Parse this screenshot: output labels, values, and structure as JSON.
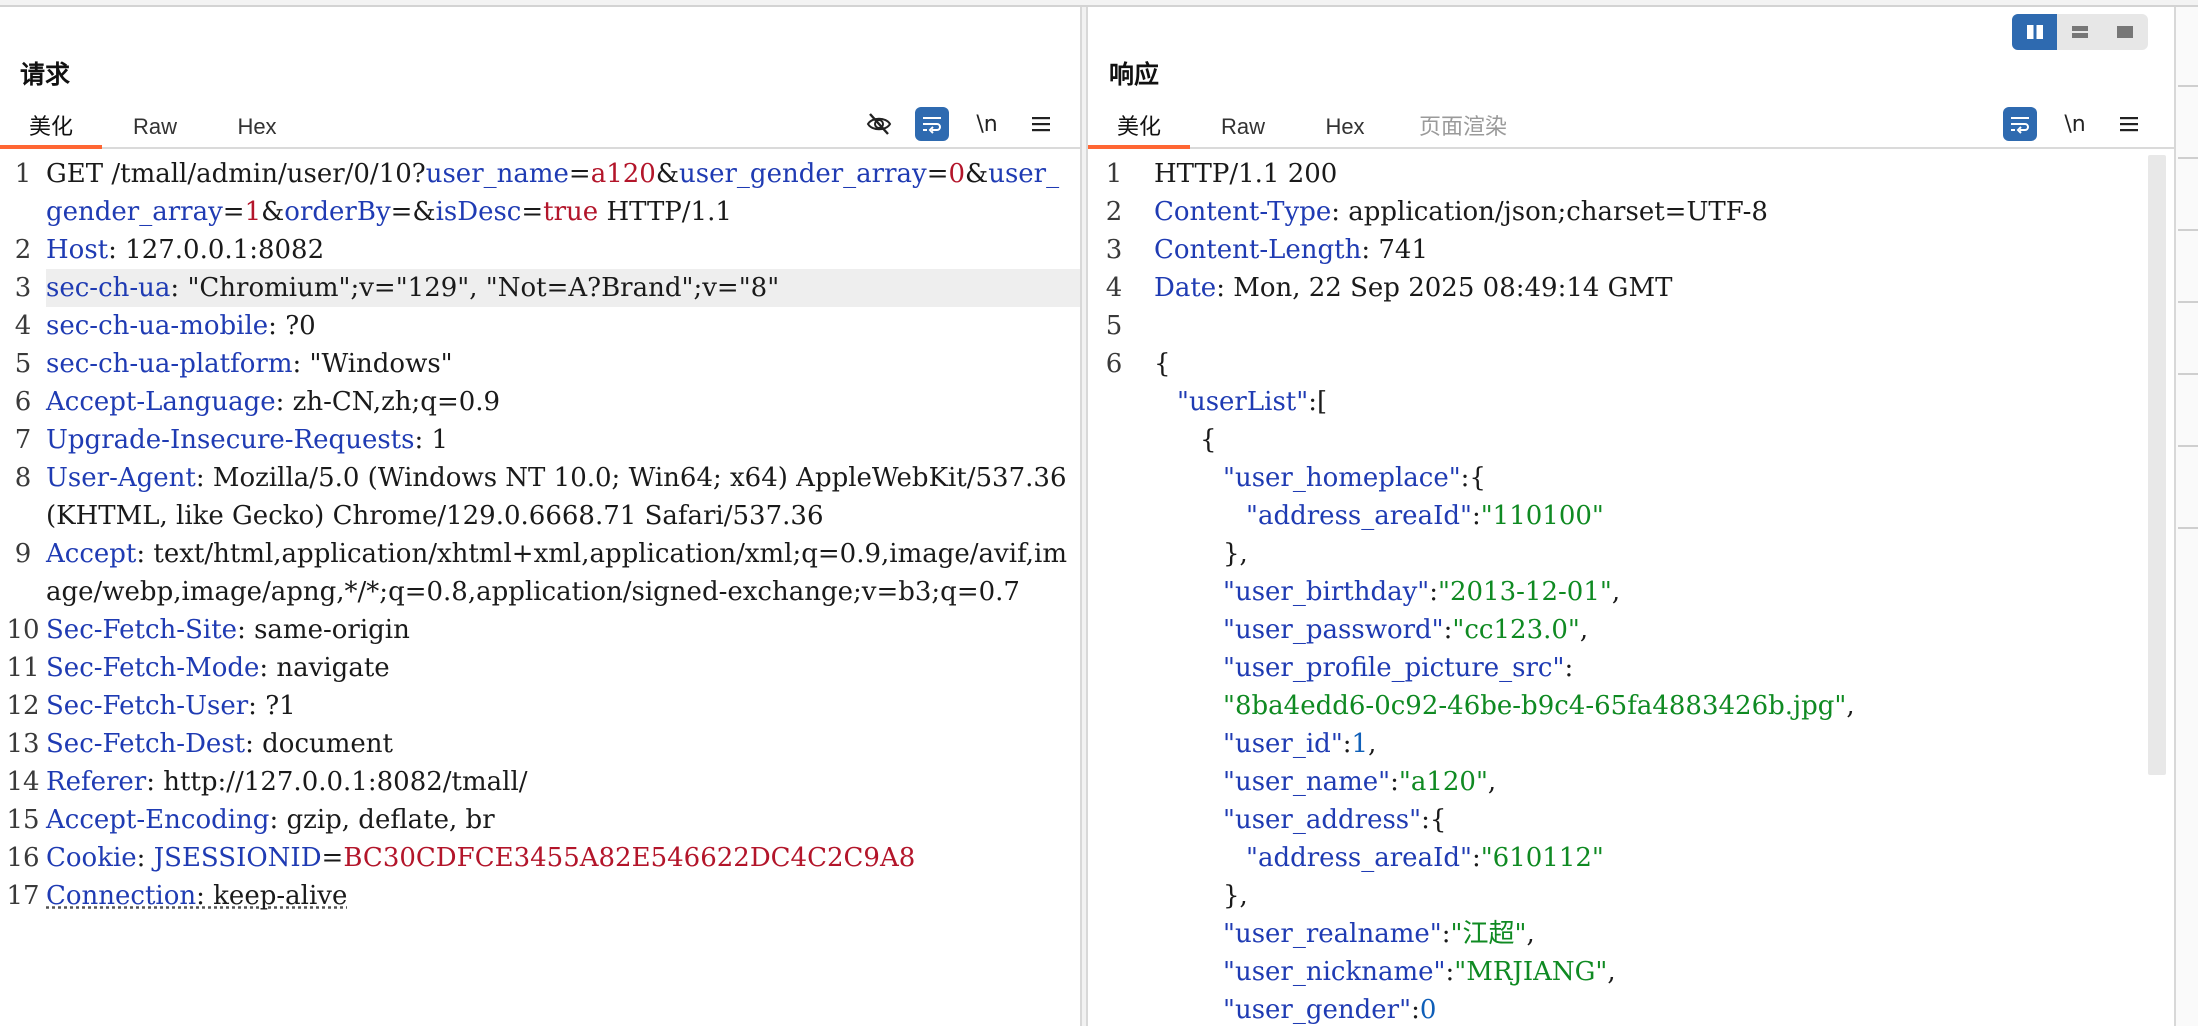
{
  "request": {
    "title": "请求",
    "tabs": [
      {
        "label": "美化",
        "active": true
      },
      {
        "label": "Raw",
        "active": false
      },
      {
        "label": "Hex",
        "active": false
      }
    ],
    "tools": {
      "wrap_newline": "\\n",
      "menu_icon": "menu-icon",
      "hide_icon": "eye-off-icon",
      "wrap_icon": "wrap-icon"
    },
    "lines": [
      {
        "n": "1",
        "segs": [
          {
            "t": "GET /tmall/admin/user/0/10?",
            "c": "dim"
          },
          {
            "t": "user_name",
            "c": "k"
          },
          {
            "t": "=",
            "c": "dim"
          },
          {
            "t": "a120",
            "c": "v"
          },
          {
            "t": "&",
            "c": "dim"
          },
          {
            "t": "user_gender_array",
            "c": "k"
          },
          {
            "t": "=",
            "c": "dim"
          },
          {
            "t": "0",
            "c": "v"
          },
          {
            "t": "&",
            "c": "dim"
          },
          {
            "t": "user_gender_array",
            "c": "k"
          },
          {
            "t": "=",
            "c": "dim"
          },
          {
            "t": "1",
            "c": "v"
          },
          {
            "t": "&",
            "c": "dim"
          },
          {
            "t": "orderBy",
            "c": "k"
          },
          {
            "t": "=&",
            "c": "dim"
          },
          {
            "t": "isDesc",
            "c": "k"
          },
          {
            "t": "=",
            "c": "dim"
          },
          {
            "t": "true",
            "c": "v"
          },
          {
            "t": " HTTP/1.1",
            "c": "dim"
          }
        ]
      },
      {
        "n": "2",
        "segs": [
          {
            "t": "Host",
            "c": "k"
          },
          {
            "t": ": 127.0.0.1:8082",
            "c": "dim"
          }
        ]
      },
      {
        "n": "3",
        "hl": true,
        "segs": [
          {
            "t": "sec-ch-ua",
            "c": "k"
          },
          {
            "t": ": \"Chromium\";v=\"129\", \"Not=A?Brand\";v=\"8\"",
            "c": "dim"
          }
        ]
      },
      {
        "n": "4",
        "segs": [
          {
            "t": "sec-ch-ua-mobile",
            "c": "k"
          },
          {
            "t": ": ?0",
            "c": "dim"
          }
        ]
      },
      {
        "n": "5",
        "segs": [
          {
            "t": "sec-ch-ua-platform",
            "c": "k"
          },
          {
            "t": ": \"Windows\"",
            "c": "dim"
          }
        ]
      },
      {
        "n": "6",
        "segs": [
          {
            "t": "Accept-Language",
            "c": "k"
          },
          {
            "t": ": zh-CN,zh;q=0.9",
            "c": "dim"
          }
        ]
      },
      {
        "n": "7",
        "segs": [
          {
            "t": "Upgrade-Insecure-Requests",
            "c": "k"
          },
          {
            "t": ": 1",
            "c": "dim"
          }
        ]
      },
      {
        "n": "8",
        "segs": [
          {
            "t": "User-Agent",
            "c": "k"
          },
          {
            "t": ": Mozilla/5.0 (Windows NT 10.0; Win64; x64) AppleWebKit/537.36 (KHTML, like Gecko) Chrome/129.0.6668.71 Safari/537.36",
            "c": "dim"
          }
        ]
      },
      {
        "n": "9",
        "segs": [
          {
            "t": "Accept",
            "c": "k"
          },
          {
            "t": ": text/html,application/xhtml+xml,application/xml;q=0.9,image/avif,image/webp,image/apng,*/*;q=0.8,application/signed-exchange;v=b3;q=0.7",
            "c": "dim"
          }
        ]
      },
      {
        "n": "10",
        "segs": [
          {
            "t": "Sec-Fetch-Site",
            "c": "k"
          },
          {
            "t": ": same-origin",
            "c": "dim"
          }
        ]
      },
      {
        "n": "11",
        "segs": [
          {
            "t": "Sec-Fetch-Mode",
            "c": "k"
          },
          {
            "t": ": navigate",
            "c": "dim"
          }
        ]
      },
      {
        "n": "12",
        "segs": [
          {
            "t": "Sec-Fetch-User",
            "c": "k"
          },
          {
            "t": ": ?1",
            "c": "dim"
          }
        ]
      },
      {
        "n": "13",
        "segs": [
          {
            "t": "Sec-Fetch-Dest",
            "c": "k"
          },
          {
            "t": ": document",
            "c": "dim"
          }
        ]
      },
      {
        "n": "14",
        "segs": [
          {
            "t": "Referer",
            "c": "k"
          },
          {
            "t": ": http://127.0.0.1:8082/tmall/",
            "c": "dim"
          }
        ]
      },
      {
        "n": "15",
        "segs": [
          {
            "t": "Accept-Encoding",
            "c": "k"
          },
          {
            "t": ": gzip, deflate, br",
            "c": "dim"
          }
        ]
      },
      {
        "n": "16",
        "segs": [
          {
            "t": "Cookie",
            "c": "k"
          },
          {
            "t": ": ",
            "c": "dim"
          },
          {
            "t": "JSESSIONID",
            "c": "k"
          },
          {
            "t": "=",
            "c": "dim"
          },
          {
            "t": "BC30CDFCE3455A82E546622DC4C2C9A8",
            "c": "v"
          }
        ]
      },
      {
        "n": "17",
        "segs": [
          {
            "t": "Connection",
            "c": "k"
          },
          {
            "t": ": keep-alive",
            "c": "dim"
          }
        ]
      }
    ]
  },
  "response": {
    "title": "响应",
    "tabs": [
      {
        "label": "美化",
        "active": true
      },
      {
        "label": "Raw",
        "active": false
      },
      {
        "label": "Hex",
        "active": false
      },
      {
        "label": "页面渲染",
        "active": false,
        "muted": true
      }
    ],
    "tools": {
      "wrap_newline": "\\n",
      "menu_icon": "menu-icon",
      "wrap_icon": "wrap-icon"
    },
    "lines": [
      {
        "n": "1",
        "segs": [
          {
            "t": "HTTP/1.1 200",
            "c": "dim"
          }
        ]
      },
      {
        "n": "2",
        "segs": [
          {
            "t": "Content-Type",
            "c": "k"
          },
          {
            "t": ": application/json;charset=UTF-8",
            "c": "dim"
          }
        ]
      },
      {
        "n": "3",
        "segs": [
          {
            "t": "Content-Length",
            "c": "k"
          },
          {
            "t": ": 741",
            "c": "dim"
          }
        ]
      },
      {
        "n": "4",
        "segs": [
          {
            "t": "Date",
            "c": "k"
          },
          {
            "t": ": Mon, 22 Sep 2025 08:49:14 GMT",
            "c": "dim"
          }
        ]
      },
      {
        "n": "5",
        "segs": [
          {
            "t": "",
            "c": "dim"
          }
        ]
      },
      {
        "n": "6",
        "segs": [
          {
            "t": "{",
            "c": "dim"
          }
        ]
      },
      {
        "n": "",
        "indent": 1,
        "segs": [
          {
            "t": "\"userList\"",
            "c": "k"
          },
          {
            "t": ":[",
            "c": "dim"
          }
        ]
      },
      {
        "n": "",
        "indent": 2,
        "segs": [
          {
            "t": "{",
            "c": "dim"
          }
        ]
      },
      {
        "n": "",
        "indent": 3,
        "segs": [
          {
            "t": "\"user_homeplace\"",
            "c": "k"
          },
          {
            "t": ":{",
            "c": "dim"
          }
        ]
      },
      {
        "n": "",
        "indent": 4,
        "segs": [
          {
            "t": "\"address_areaId\"",
            "c": "k"
          },
          {
            "t": ":",
            "c": "dim"
          },
          {
            "t": "\"110100\"",
            "c": "s"
          }
        ]
      },
      {
        "n": "",
        "indent": 3,
        "segs": [
          {
            "t": "},",
            "c": "dim"
          }
        ]
      },
      {
        "n": "",
        "indent": 3,
        "segs": [
          {
            "t": "\"user_birthday\"",
            "c": "k"
          },
          {
            "t": ":",
            "c": "dim"
          },
          {
            "t": "\"2013-12-01\"",
            "c": "s"
          },
          {
            "t": ",",
            "c": "dim"
          }
        ]
      },
      {
        "n": "",
        "indent": 3,
        "segs": [
          {
            "t": "\"user_password\"",
            "c": "k"
          },
          {
            "t": ":",
            "c": "dim"
          },
          {
            "t": "\"cc123.0\"",
            "c": "s"
          },
          {
            "t": ",",
            "c": "dim"
          }
        ]
      },
      {
        "n": "",
        "indent": 3,
        "segs": [
          {
            "t": "\"user_profile_picture_src\"",
            "c": "k"
          },
          {
            "t": ":",
            "c": "dim"
          }
        ]
      },
      {
        "n": "",
        "indent": 3,
        "segs": [
          {
            "t": "\"8ba4edd6-0c92-46be-b9c4-65fa4883426b.jpg\"",
            "c": "s"
          },
          {
            "t": ",",
            "c": "dim"
          }
        ]
      },
      {
        "n": "",
        "indent": 3,
        "segs": [
          {
            "t": "\"user_id\"",
            "c": "k"
          },
          {
            "t": ":",
            "c": "dim"
          },
          {
            "t": "1",
            "c": "n"
          },
          {
            "t": ",",
            "c": "dim"
          }
        ]
      },
      {
        "n": "",
        "indent": 3,
        "segs": [
          {
            "t": "\"user_name\"",
            "c": "k"
          },
          {
            "t": ":",
            "c": "dim"
          },
          {
            "t": "\"a120\"",
            "c": "s"
          },
          {
            "t": ",",
            "c": "dim"
          }
        ]
      },
      {
        "n": "",
        "indent": 3,
        "segs": [
          {
            "t": "\"user_address\"",
            "c": "k"
          },
          {
            "t": ":{",
            "c": "dim"
          }
        ]
      },
      {
        "n": "",
        "indent": 4,
        "segs": [
          {
            "t": "\"address_areaId\"",
            "c": "k"
          },
          {
            "t": ":",
            "c": "dim"
          },
          {
            "t": "\"610112\"",
            "c": "s"
          }
        ]
      },
      {
        "n": "",
        "indent": 3,
        "segs": [
          {
            "t": "},",
            "c": "dim"
          }
        ]
      },
      {
        "n": "",
        "indent": 3,
        "segs": [
          {
            "t": "\"user_realname\"",
            "c": "k"
          },
          {
            "t": ":",
            "c": "dim"
          },
          {
            "t": "\"江超\"",
            "c": "s"
          },
          {
            "t": ",",
            "c": "dim"
          }
        ]
      },
      {
        "n": "",
        "indent": 3,
        "segs": [
          {
            "t": "\"user_nickname\"",
            "c": "k"
          },
          {
            "t": ":",
            "c": "dim"
          },
          {
            "t": "\"MRJIANG\"",
            "c": "s"
          },
          {
            "t": ",",
            "c": "dim"
          }
        ]
      },
      {
        "n": "",
        "indent": 3,
        "segs": [
          {
            "t": "\"user_gender\"",
            "c": "k"
          },
          {
            "t": ":",
            "c": "dim"
          },
          {
            "t": "0",
            "c": "n"
          }
        ]
      }
    ]
  },
  "layout_toggle": [
    "split-horizontal-icon",
    "split-vertical-icon",
    "single-pane-icon"
  ],
  "colors": {
    "accent": "#2e6ab0",
    "tab_active": "#ff6633",
    "key": "#1f3bb3",
    "value": "#b3152a",
    "string": "#0f8a22"
  }
}
